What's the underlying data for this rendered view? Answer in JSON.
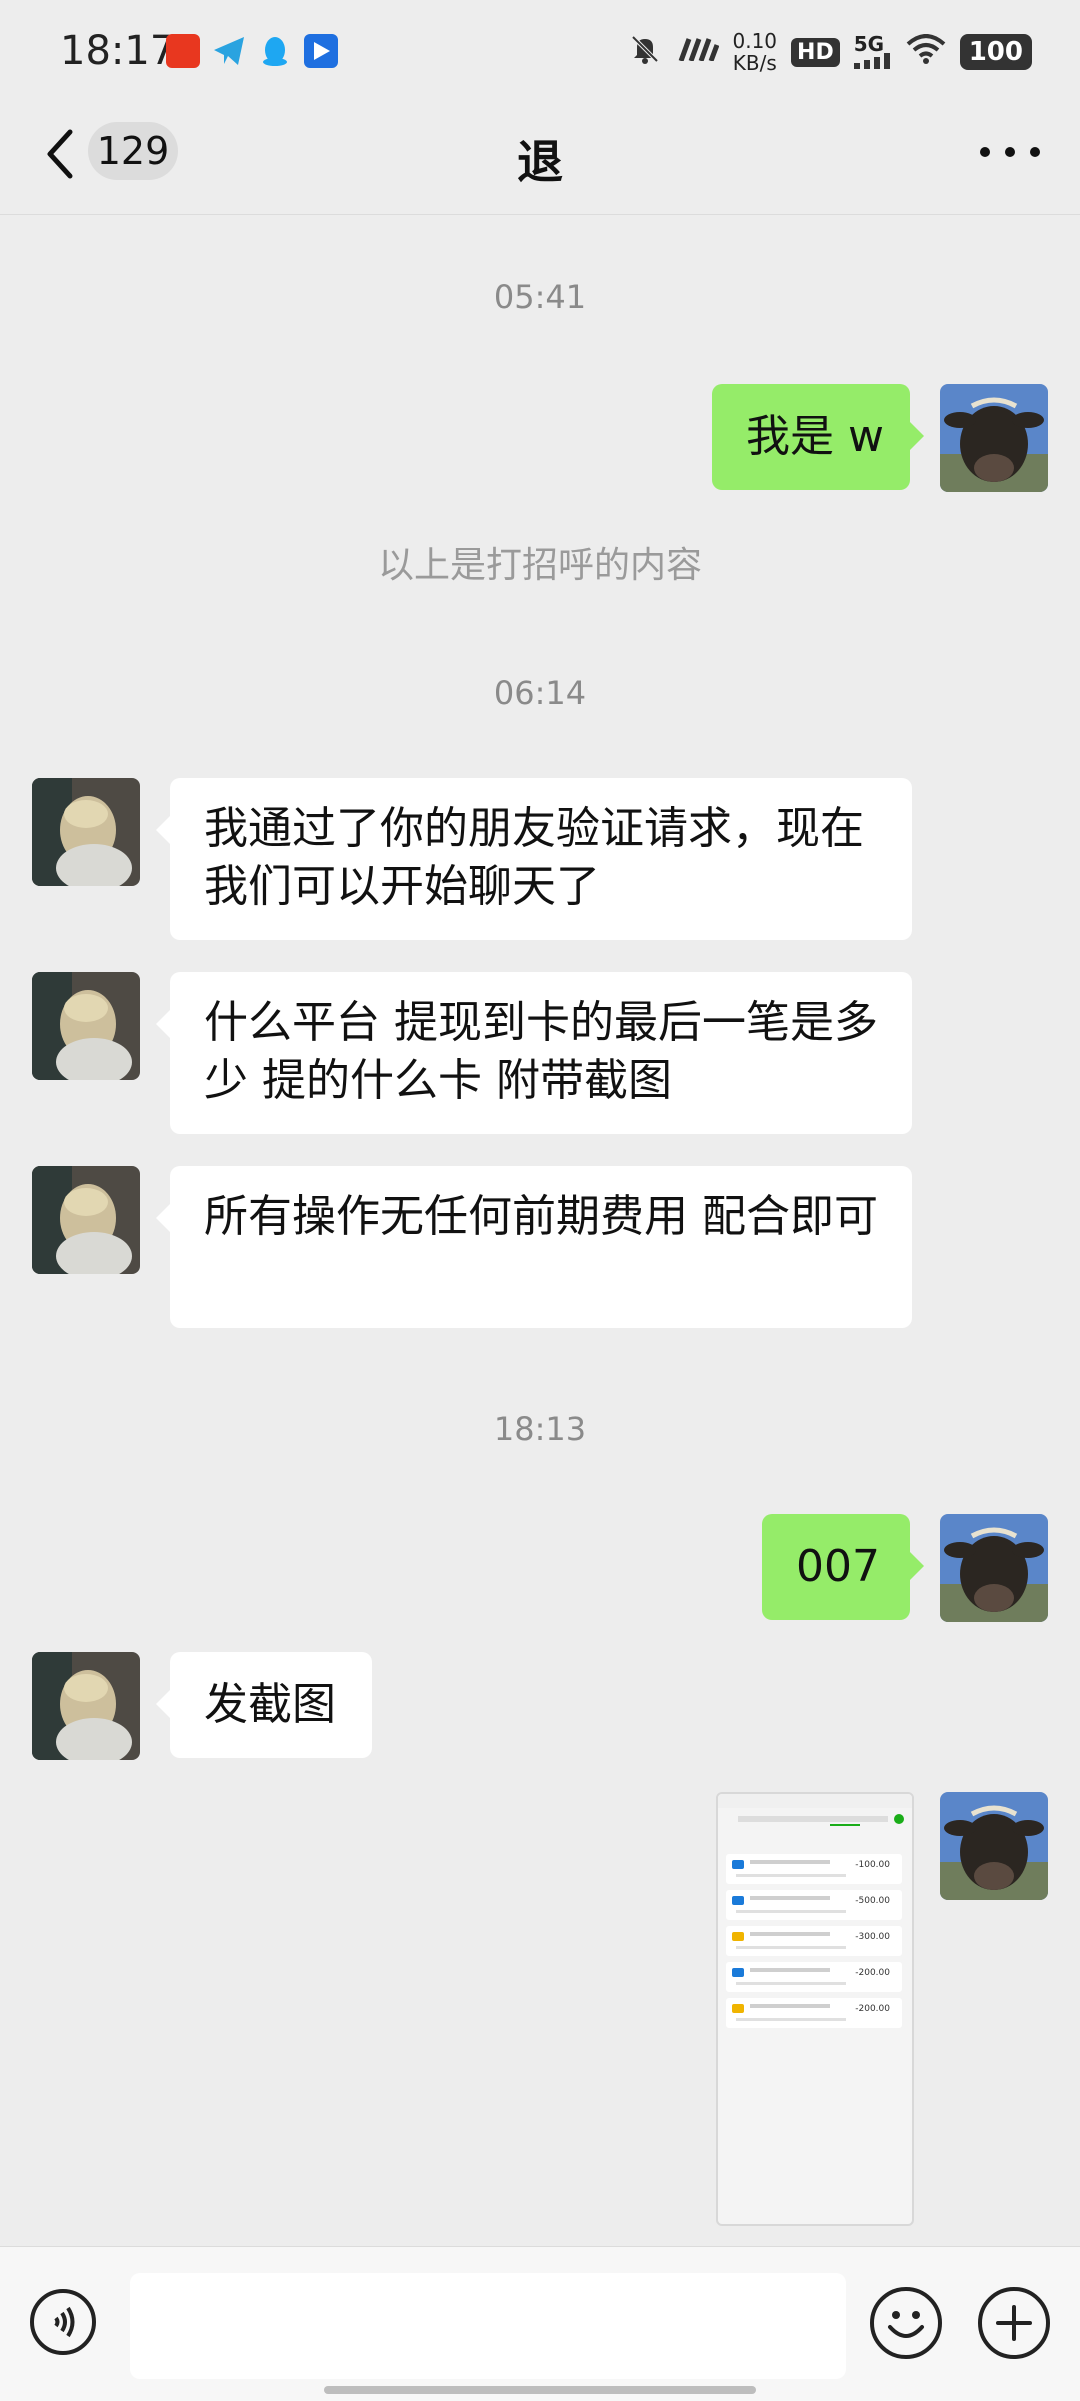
{
  "status_bar": {
    "time": "18:17",
    "net_speed_value": "0.10",
    "net_speed_unit": "KB/s",
    "hd": "HD",
    "network": "5G",
    "battery": "100"
  },
  "header": {
    "unread_count": "129",
    "title": "退"
  },
  "messages": {
    "ts1": "05:41",
    "m1": "我是 w",
    "system_note": "以上是打招呼的内容",
    "ts2": "06:14",
    "m2": "我通过了你的朋友验证请求，现在我们可以开始聊天了",
    "m3": "什么平台 提现到卡的最后一笔是多少 提的什么卡 附带截图",
    "m4": "所有操作无任何前期费用 配合即可",
    "ts3": "18:13",
    "m5": "007",
    "m6": "发截图"
  },
  "screenshot_thumbnail": {
    "amounts": [
      "-100.00",
      "-500.00",
      "-300.00",
      "-200.00",
      "-200.00"
    ]
  },
  "input": {
    "placeholder": ""
  }
}
